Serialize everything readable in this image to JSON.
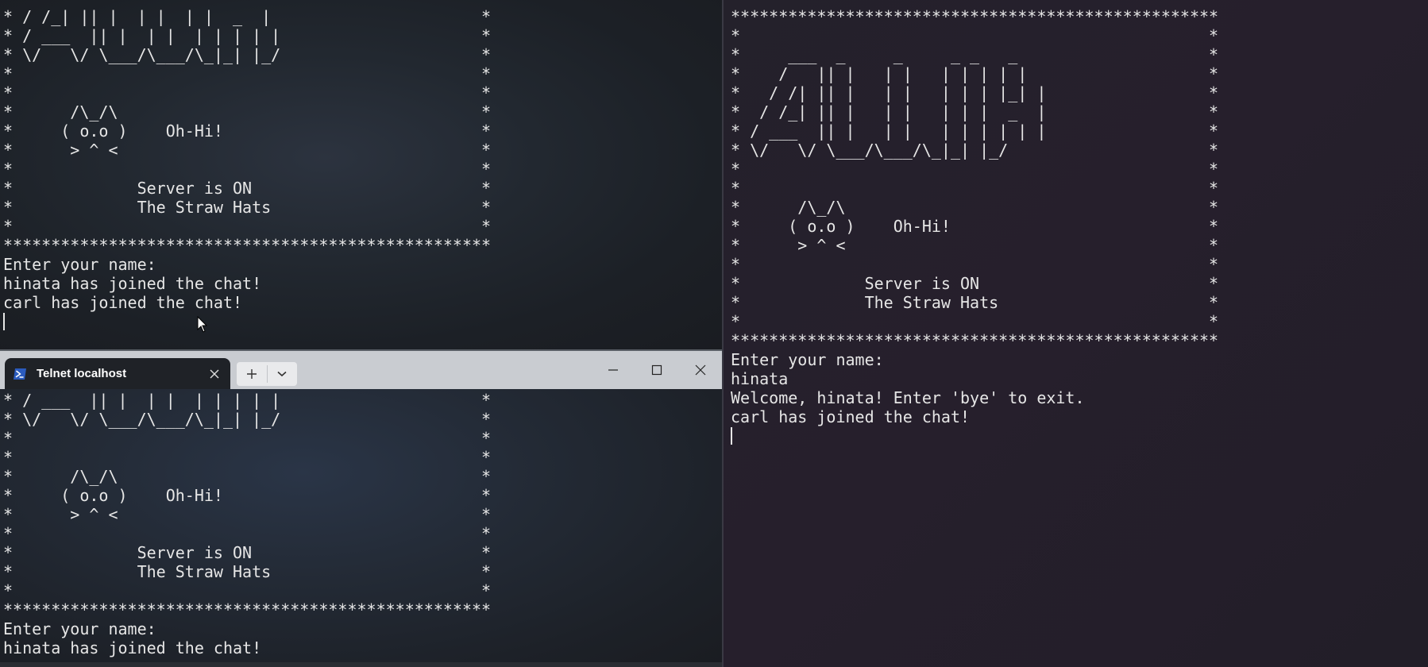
{
  "top_left_terminal": {
    "lines": [
      "* / /_| || |  | |  | |  _  |                      *",
      "* / ___  || |  | |  | | | | |                     *",
      "* \\/   \\/ \\___/\\___/\\_|_| |_/                     *",
      "*                                                 *",
      "*                                                 *",
      "*      /\\_/\\                                      *",
      "*     ( o.o )    Oh-Hi!                           *",
      "*      > ^ <                                      *",
      "*                                                 *",
      "*             Server is ON                        *",
      "*             The Straw Hats                      *",
      "*                                                 *",
      "***************************************************",
      "Enter your name:",
      "hinata has joined the chat!",
      "carl has joined the chat!"
    ]
  },
  "bottom_left_window": {
    "tab_title": "Telnet localhost",
    "icons": {
      "tab": "powershell-icon",
      "close_tab": "close-icon",
      "new_tab": "plus-icon",
      "dropdown": "chevron-down-icon",
      "minimize": "minimize-icon",
      "maximize": "maximize-icon",
      "close_window": "close-icon"
    },
    "lines": [
      "* / ___  || |  | |  | | | | |                     *",
      "* \\/   \\/ \\___/\\___/\\_|_| |_/                     *",
      "*                                                 *",
      "*                                                 *",
      "*      /\\_/\\                                      *",
      "*     ( o.o )    Oh-Hi!                           *",
      "*      > ^ <                                      *",
      "*                                                 *",
      "*             Server is ON                        *",
      "*             The Straw Hats                      *",
      "*                                                 *",
      "***************************************************",
      "Enter your name:",
      "hinata has joined the chat!"
    ]
  },
  "right_terminal": {
    "lines": [
      "***************************************************",
      "*                                                 *",
      "*     ___  _     _     _ _   _                    *",
      "*    /   || |   | |   | | | | |                   *",
      "*   / /| || |   | |   | | | |_| |                 *",
      "*  / /_| || |   | |   | | |  _  |                 *",
      "* / ___  || |   | |   | | | | | |                 *",
      "* \\/   \\/ \\___/\\___/\\_|_| |_/                     *",
      "*                                                 *",
      "*                                                 *",
      "*      /\\_/\\                                      *",
      "*     ( o.o )    Oh-Hi!                           *",
      "*      > ^ <                                      *",
      "*                                                 *",
      "*             Server is ON                        *",
      "*             The Straw Hats                      *",
      "*                                                 *",
      "***************************************************",
      "Enter your name:",
      "hinata",
      "Welcome, hinata! Enter 'bye' to exit.",
      "carl has joined the chat!"
    ]
  },
  "colors": {
    "terminal_text": "#e6e6e6",
    "titlebar": "#c9ccd1",
    "active_tab": "#1f2227",
    "powershell_blue": "#2b5bbd"
  }
}
